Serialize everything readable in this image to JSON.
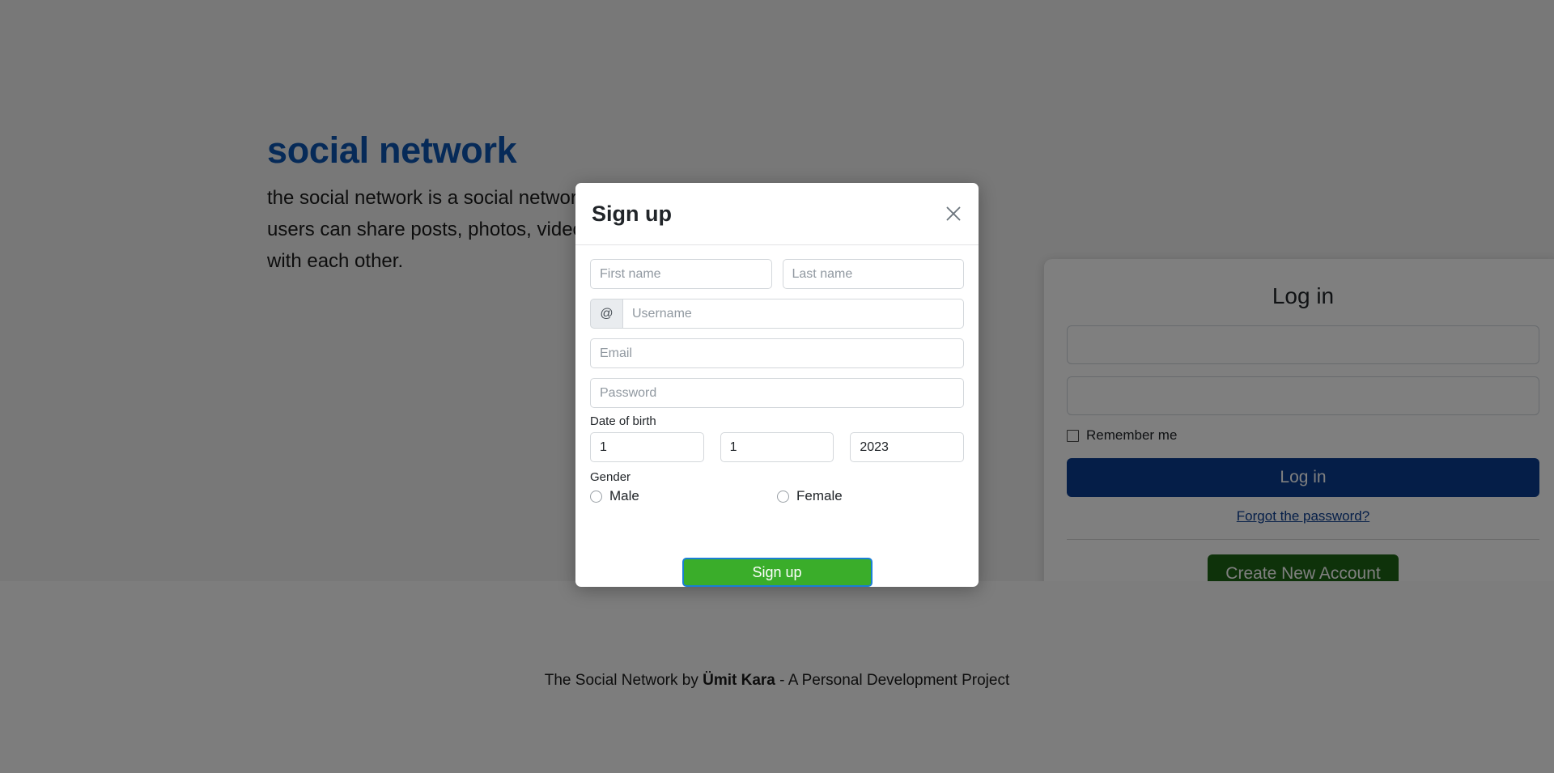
{
  "hero": {
    "title": "social network",
    "description": "the social network is a social networking site where users can share posts, photos, videos and other content with each other."
  },
  "login_card": {
    "title": "Log in",
    "email_value": "",
    "email_placeholder": "",
    "password_value": "",
    "password_placeholder": "",
    "remember_label": "Remember me",
    "login_button": "Log in",
    "forgot_link": "Forgot the password?",
    "create_account_button": "Create New Account",
    "login_button_color": "#0a3d91",
    "create_account_button_color": "#1c6414"
  },
  "footer": {
    "prefix": "The Social Network by ",
    "author": "Ümit Kara",
    "suffix": " - A Personal Development Project"
  },
  "signup_modal": {
    "title": "Sign up",
    "close_icon": "close-icon",
    "first_name_placeholder": "First name",
    "first_name_value": "",
    "last_name_placeholder": "Last name",
    "last_name_value": "",
    "username_prefix": "@",
    "username_placeholder": "Username",
    "username_value": "",
    "email_placeholder": "Email",
    "email_value": "",
    "password_placeholder": "Password",
    "password_value": "",
    "dob_label": "Date of birth",
    "dob_day": "1",
    "dob_month": "1",
    "dob_year": "2023",
    "gender_label": "Gender",
    "gender_male": "Male",
    "gender_female": "Female",
    "gender_selected": "",
    "submit_button": "Sign up",
    "submit_button_color": "#3aad2a",
    "submit_focus_ring_color": "#1a7fd4"
  }
}
